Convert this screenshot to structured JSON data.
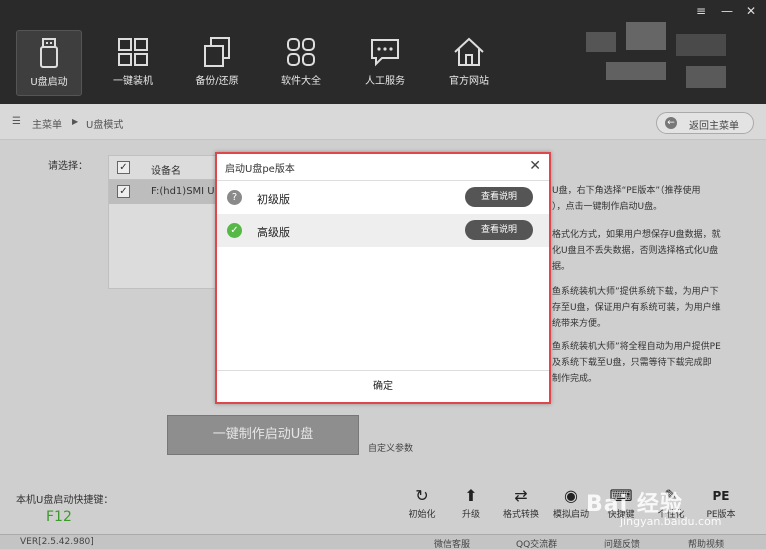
{
  "window": {
    "menu_glyph": "≡",
    "minimize_glyph": "—",
    "close_glyph": "✕"
  },
  "nav": [
    {
      "label": "U盘启动",
      "icon": "usb-drive-icon"
    },
    {
      "label": "一键装机",
      "icon": "windows-icon"
    },
    {
      "label": "备份/还原",
      "icon": "backup-restore-icon"
    },
    {
      "label": "软件大全",
      "icon": "software-grid-icon"
    },
    {
      "label": "人工服务",
      "icon": "chat-service-icon"
    },
    {
      "label": "官方网站",
      "icon": "home-icon"
    }
  ],
  "breadcrumb": {
    "root": "主菜单",
    "sep": "▶",
    "current": "U盘模式"
  },
  "back_button": {
    "label": "返回主菜单"
  },
  "device_panel": {
    "select_label": "请选择：",
    "header": "设备名",
    "rows": [
      {
        "name": "F:(hd1)SMI US",
        "checked": true
      }
    ]
  },
  "side_text": [
    "U盘，右下角选择“PE版本”（推荐使用",
    "），点击一键制作启动U盘。",
    "格式化方式，如果用户想保存U盘数据，就",
    "化U盘且不丢失数据，否则选择格式化U盘",
    "据。",
    "鱼系统装机大师”提供系统下载，为用户下",
    "存至U盘，保证用户有系统可装，为用户维",
    "统带来方便。",
    "鱼系统装机大师”将全程自动为用户提供PE",
    "及系统下载至U盘，只需等待下载完成即",
    "制作完成。"
  ],
  "make_button": {
    "label": "一键制作启动U盘"
  },
  "custom_param": "自定义参数",
  "hotkey": {
    "label": "本机U盘启动快捷键：",
    "value": "F12"
  },
  "tools": [
    {
      "label": "初始化",
      "icon": "reset-icon",
      "glyph": "↻"
    },
    {
      "label": "升级",
      "icon": "upload-icon",
      "glyph": "⬆"
    },
    {
      "label": "格式转换",
      "icon": "convert-icon",
      "glyph": "⇄"
    },
    {
      "label": "模拟启动",
      "icon": "eye-icon",
      "glyph": "◉"
    },
    {
      "label": "快捷键",
      "icon": "keyboard-icon",
      "glyph": "⌨"
    },
    {
      "label": "个性化",
      "icon": "personalize-icon",
      "glyph": "✎"
    },
    {
      "label": "PE版本",
      "icon": "pe-icon",
      "glyph": "PE"
    }
  ],
  "watermark": {
    "text": "Bai 经验",
    "sub": "jingyan.baidu.com"
  },
  "status": {
    "version": "VER[2.5.42.980]",
    "links": [
      "微信客服",
      "QQ交流群",
      "问题反馈",
      "帮助视频"
    ]
  },
  "modal": {
    "title": "启动U盘pe版本",
    "close_glyph": "✕",
    "options": [
      {
        "label": "初级版",
        "button": "查看说明",
        "icon": "question-icon",
        "glyph": "?",
        "selected": false,
        "color": "#8a8a8a"
      },
      {
        "label": "高级版",
        "button": "查看说明",
        "icon": "check-icon",
        "glyph": "✓",
        "selected": true,
        "color": "#57b848"
      }
    ],
    "confirm": "确定"
  }
}
